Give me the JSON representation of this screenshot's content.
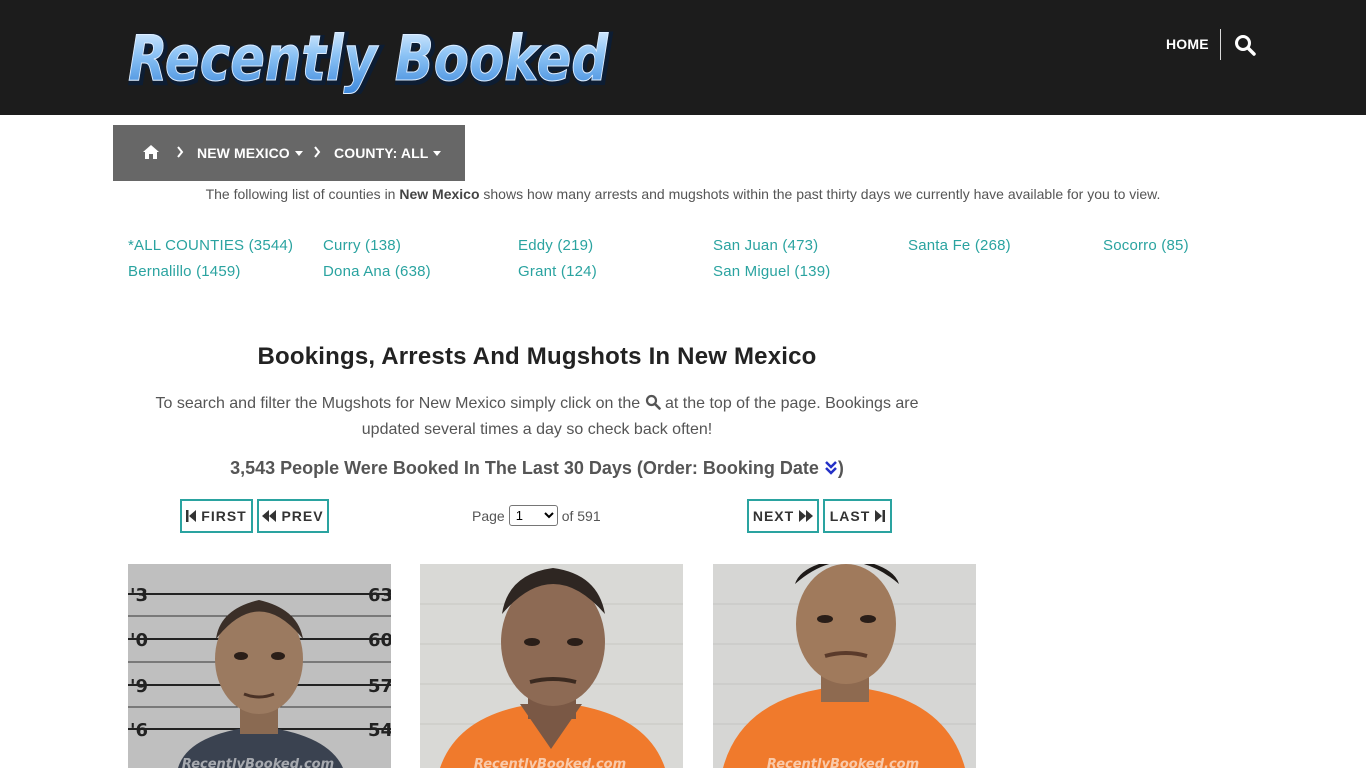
{
  "header": {
    "logo_text": "Recently Booked",
    "nav_home": "HOME",
    "search_icon": "search-icon"
  },
  "breadcrumb": {
    "home_icon": "home-icon",
    "state": "NEW MEXICO",
    "county": "COUNTY: ALL"
  },
  "intro": {
    "before": "The following list of counties in ",
    "state": "New Mexico",
    "after": " shows how many arrests and mugshots within the past thirty days we currently have available for you to view."
  },
  "counties": [
    "*ALL COUNTIES (3544)",
    "Curry (138)",
    "Eddy (219)",
    "San Juan (473)",
    "Santa Fe (268)",
    "Socorro (85)",
    "Bernalillo (1459)",
    "Dona Ana (638)",
    "Grant (124)",
    "San Miguel (139)"
  ],
  "main": {
    "heading": "Bookings, Arrests And Mugshots In New Mexico",
    "search_help_before": "To search and filter the Mugshots for New Mexico simply click on the ",
    "search_help_after": " at the top of the page. Bookings are updated several times a day so check back often!",
    "booked_text": "3,543 People Were Booked In The Last 30 Days (Order: Booking Date ",
    "booked_close": ")"
  },
  "pagination": {
    "first": "FIRST",
    "prev": "PREV",
    "next": "NEXT",
    "last": "LAST",
    "page_label": "Page",
    "current_page": "1",
    "of_label": "of 591"
  },
  "mugshots": {
    "watermark": "RecentlyBooked.com",
    "height_marks": [
      "3",
      "0",
      "9",
      "6",
      "63",
      "60",
      "57",
      "54"
    ]
  },
  "colors": {
    "header_bg": "#1c1c1c",
    "accent": "#2aa3a0",
    "breadcrumb_bg": "#676767",
    "order_icon": "#2431c7"
  }
}
